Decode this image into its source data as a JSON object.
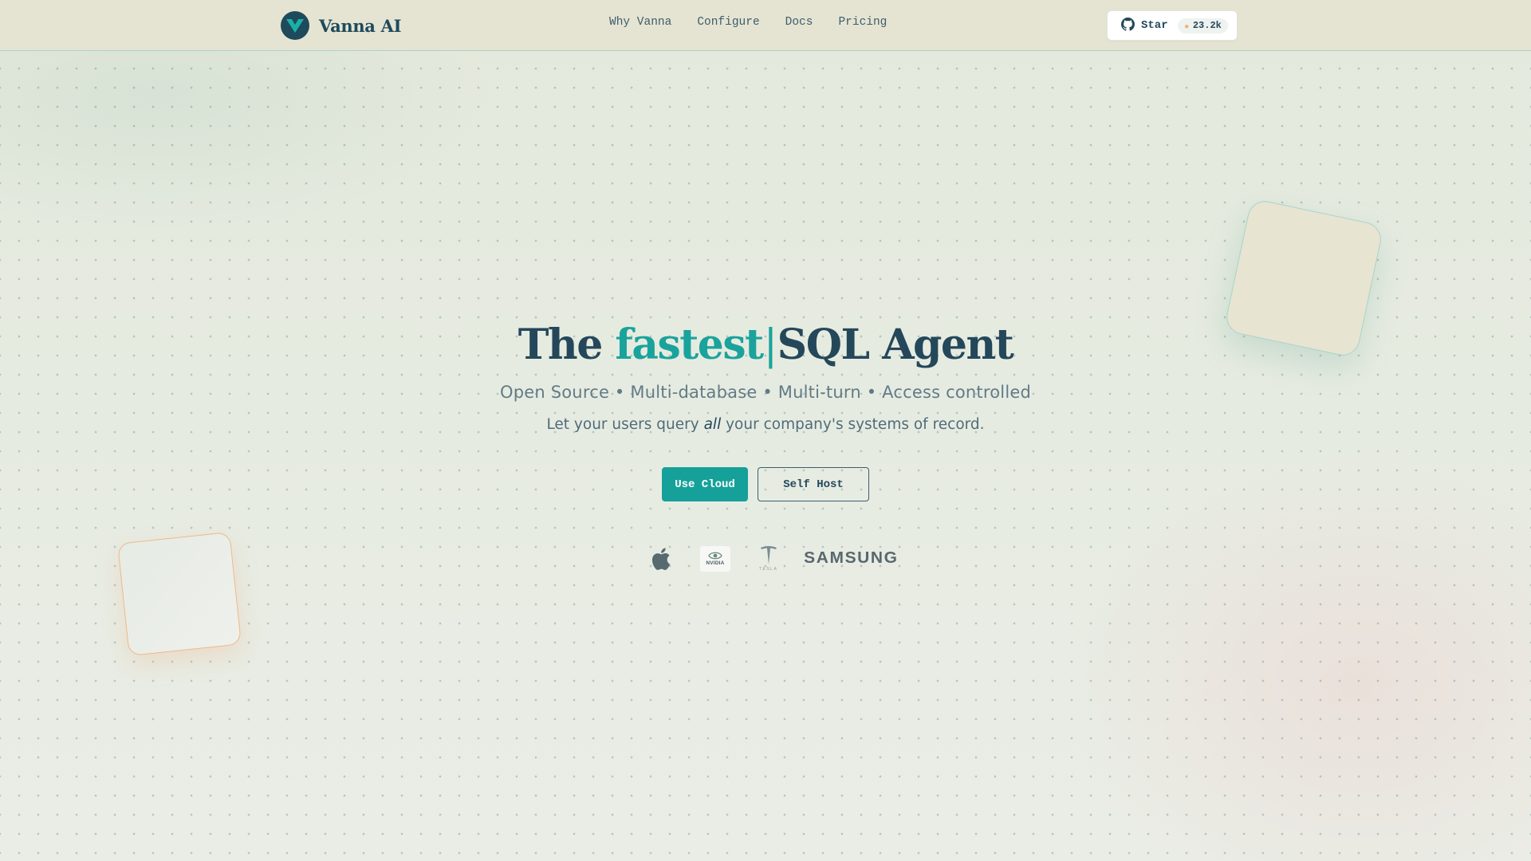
{
  "brand": {
    "name": "Vanna AI",
    "logo_icon": "vanna-v-logo-icon"
  },
  "nav": {
    "items": [
      {
        "label": "Why Vanna"
      },
      {
        "label": "Configure"
      },
      {
        "label": "Docs"
      },
      {
        "label": "Pricing"
      }
    ]
  },
  "github": {
    "star_label": "Star",
    "count": "23.2k",
    "icon": "github-icon",
    "star_icon": "star-icon"
  },
  "hero": {
    "title_pre": "The",
    "title_accent": "fastest",
    "caret": "|",
    "title_post": "SQL Agent",
    "subtitle": "Open Source • Multi-database • Multi-turn • Access controlled",
    "tagline_pre": "Let your users query",
    "tagline_em": "all",
    "tagline_post": "your company's systems of record."
  },
  "actions": {
    "primary": "Use Cloud",
    "secondary": "Self Host"
  },
  "logos": {
    "apple_icon": "apple-logo-icon",
    "nvidia_text": "NVIDIA",
    "tesla_text": "TESLA",
    "samsung_text": "SAMSUNG"
  },
  "colors": {
    "accent": "#15a19a",
    "primary_text": "#24475a",
    "header_bg": "#e5e4d2",
    "star": "#f0a45c"
  }
}
